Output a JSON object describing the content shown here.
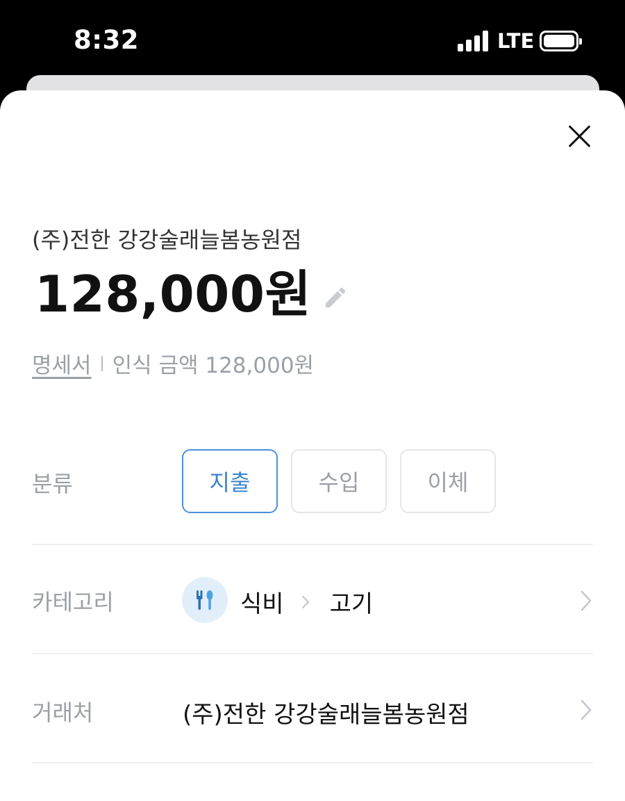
{
  "status_bar": {
    "time": "8:32",
    "network": "LTE",
    "icons": [
      "signal-icon",
      "battery-icon"
    ]
  },
  "sheet": {
    "close_icon": "close-icon",
    "merchant_title": "(주)전한 강강술래늘봄농원점",
    "amount": "128,000원",
    "edit_icon": "pencil-icon",
    "receipt": {
      "link_label": "명세서",
      "recognized_amount": "인식 금액 128,000원"
    },
    "classification": {
      "label": "분류",
      "options": [
        "지출",
        "수입",
        "이체"
      ],
      "selected": "지출"
    },
    "category": {
      "label": "카테고리",
      "icon": "fork-spoon-icon",
      "main": "식비",
      "sub": "고기"
    },
    "merchant": {
      "label": "거래처",
      "value": "(주)전한 강강술래늘봄농원점"
    }
  },
  "colors": {
    "accent": "#3b84cf",
    "label_gray": "#9ba0a6",
    "category_icon_bg": "#e1effb"
  }
}
